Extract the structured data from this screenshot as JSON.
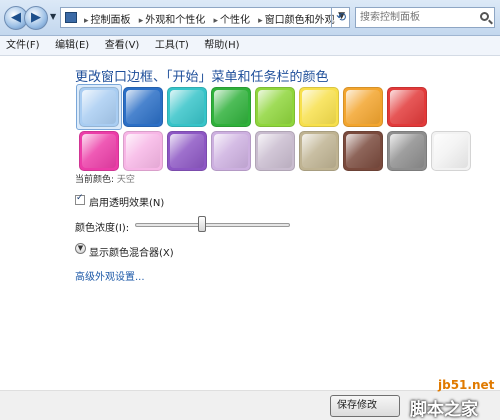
{
  "address": {
    "crumbs": [
      "控制面板",
      "外观和个性化",
      "个性化",
      "窗口颜色和外观"
    ]
  },
  "search": {
    "placeholder": "搜索控制面板"
  },
  "menu": {
    "items": [
      "文件(F)",
      "编辑(E)",
      "查看(V)",
      "工具(T)",
      "帮助(H)"
    ]
  },
  "content": {
    "heading": "更改窗口边框、「开始」菜单和任务栏的颜色",
    "swatches": [
      {
        "label": "天空",
        "color": "#a9cdf2",
        "selected": true
      },
      {
        "color": "#2b6fc6"
      },
      {
        "color": "#37c4c9"
      },
      {
        "color": "#2fb13b"
      },
      {
        "color": "#8fd63c"
      },
      {
        "color": "#f7e04c"
      },
      {
        "color": "#f3a52e"
      },
      {
        "color": "#e23a3a"
      },
      {
        "color": "#ec3da8"
      },
      {
        "color": "#f7b6e6"
      },
      {
        "color": "#8d57c4"
      },
      {
        "color": "#cdb0e0"
      },
      {
        "color": "#c9bccf"
      },
      {
        "color": "#bfb392"
      },
      {
        "color": "#7a4a3d"
      },
      {
        "color": "#8e8e8e"
      },
      {
        "color": "#f2f2f2"
      }
    ],
    "current_label": "当前颜色:",
    "current_value": "天空",
    "transparency_label": "启用透明效果(N)",
    "transparency_checked": true,
    "intensity_label": "颜色浓度(I):",
    "intensity_value": 0.43,
    "mixer_label": "显示颜色混合器(X)",
    "advanced_link": "高级外观设置..."
  },
  "footer": {
    "save_label": "保存修改"
  },
  "watermark": {
    "site": "jb51.net",
    "logo": "脚本之家"
  }
}
